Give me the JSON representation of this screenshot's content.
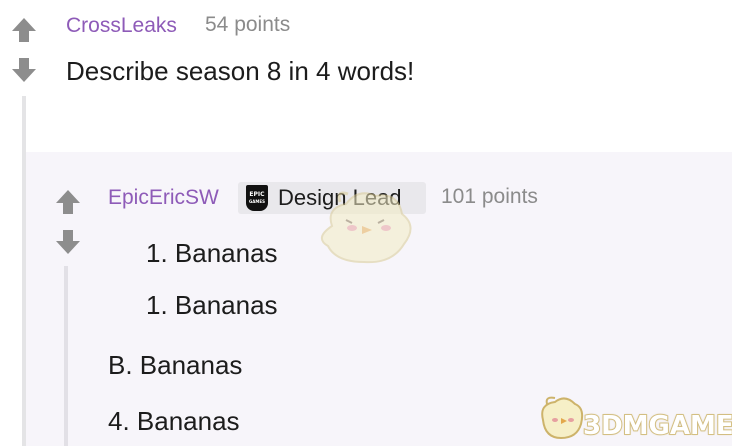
{
  "parent_comment": {
    "username": "CrossLeaks",
    "points": "54 points",
    "body": "Describe season 8 in 4 words!"
  },
  "reply": {
    "username": "EpicEricSW",
    "flair": {
      "logo_text": [
        "EPIC",
        "GAMES"
      ],
      "label": "Design Lead"
    },
    "points": "101 points",
    "lines": [
      "1. Bananas",
      "1. Bananas",
      "B. Bananas",
      "4. Bananas"
    ]
  },
  "watermark": "3DMGAME",
  "colors": {
    "username": "#8e5bb8",
    "points": "#8b8b8b",
    "vote_arrow": "#8d8d8d",
    "child_panel_bg": "#f7f5fa",
    "thread_line": "#e4e4e6"
  }
}
